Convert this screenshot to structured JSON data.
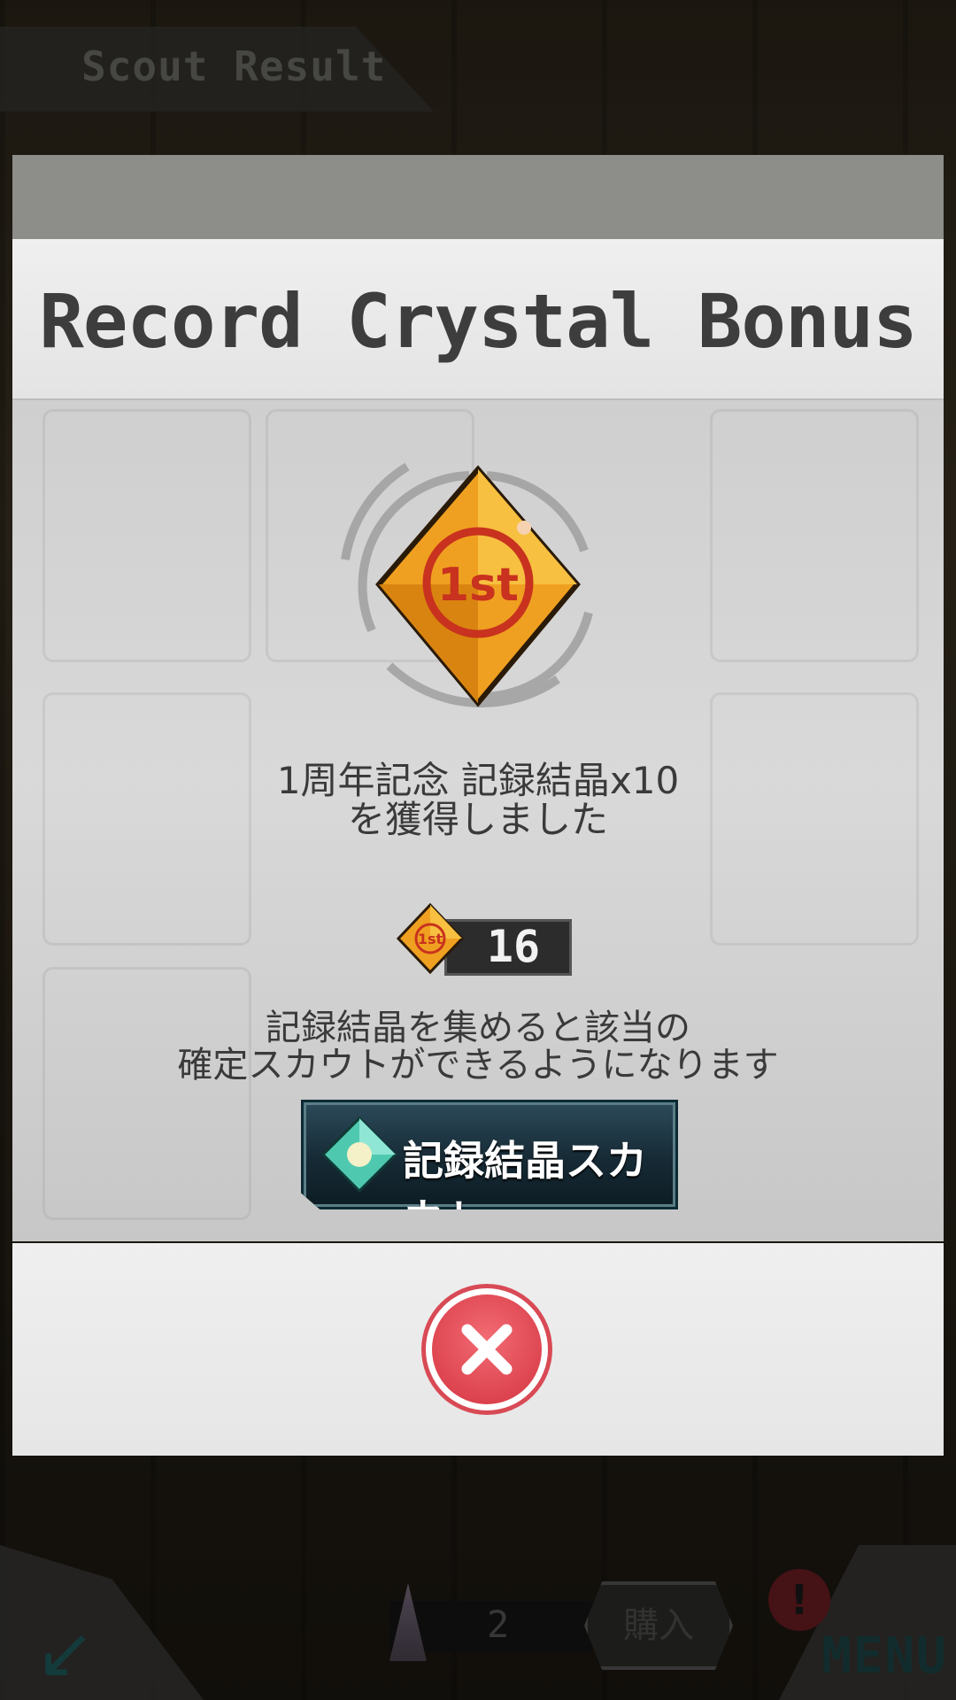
{
  "header": {
    "title": "Scout Result"
  },
  "modal": {
    "title": "Record Crystal Bonus",
    "crystal_badge": "1st",
    "gain_line1": "1周年記念 記録結晶x10",
    "gain_line2": "を獲得しました",
    "crystal_count": "16",
    "info_line1": "記録結晶を集めると該当の",
    "info_line2": "確定スカウトができるようになります",
    "scout_button_label": "記録結晶スカウト",
    "close_icon": "close-icon"
  },
  "footer_bar": {
    "item_count": "2",
    "buy_label": "購入",
    "menu_label": "MENU",
    "alert": "!"
  },
  "colors": {
    "crystal": "#f0a020",
    "crystal_mark": "#c8321e",
    "close_red": "#d43441",
    "scout_teal": "#1f4a5a"
  }
}
